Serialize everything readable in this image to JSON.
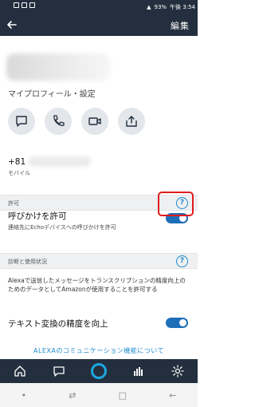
{
  "status_bar": {
    "battery": "93%",
    "time": "午後 3:54"
  },
  "app_bar": {
    "edit_label": "編集"
  },
  "profile": {
    "settings_link": "マイプロフィール・設定"
  },
  "actions": [
    "message-icon",
    "phone-icon",
    "video-icon",
    "drop-in-icon"
  ],
  "contact": {
    "phone_prefix": "+81",
    "phone_type": "モバイル"
  },
  "permission_section": {
    "header": "許可",
    "help": "?",
    "setting_title": "呼びかけを許可",
    "setting_desc": "連絡先にEchoデバイスへの呼びかけを許可",
    "enabled": true
  },
  "diagnostics_section": {
    "header": "診断と使用状況",
    "help": "?",
    "description": "Alexaで送信したメッセージをトランスクリプションの精度向上のためのデータとしてAmazonが使用することを許可する",
    "setting_title": "テキスト変換の精度を向上",
    "enabled": true
  },
  "footer_link": "ALEXAのコミュニケーション機能について",
  "bottom_nav": [
    "home-icon",
    "communicate-icon",
    "alexa-icon",
    "play-icon",
    "settings-icon"
  ],
  "system_nav": {
    "recent": "•",
    "back_arrow": "←",
    "home": "□",
    "swap": "⇄"
  },
  "colors": {
    "header_bg": "#232f3e",
    "accent": "#1d8ccf",
    "toggle_on": "#1d6fb8",
    "highlight": "#e01b1b"
  }
}
